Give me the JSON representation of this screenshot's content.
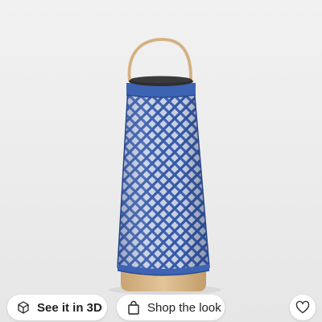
{
  "product_image": {
    "subject": "lantern",
    "colors": {
      "shade": "#3d63b3",
      "shade_dark": "#2a4688",
      "lid": "#2e2e2e",
      "handle": "#d9b88c",
      "base": "#d8b889",
      "background": "#ececec"
    }
  },
  "actions": {
    "see_3d": {
      "label": "See it in 3D",
      "icon": "3d-rotate-icon"
    },
    "shop_look": {
      "label": "Shop the look",
      "icon": "shopping-bag-icon"
    },
    "favorite": {
      "icon": "heart-icon"
    }
  }
}
